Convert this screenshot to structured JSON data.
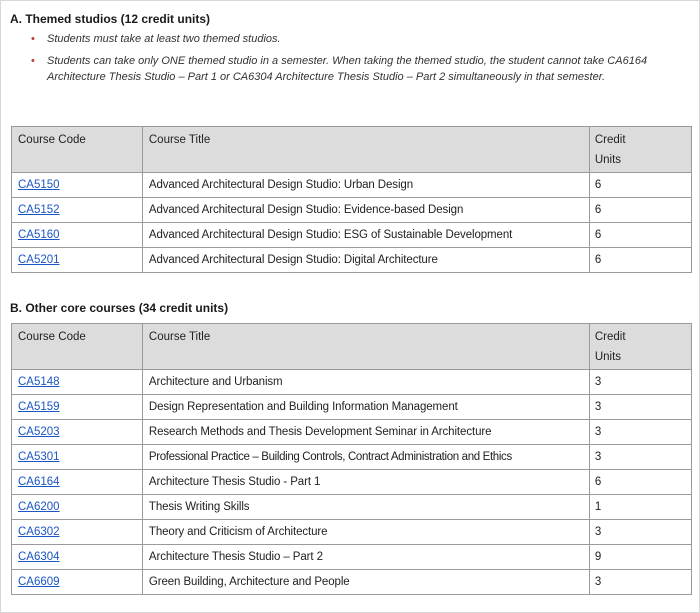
{
  "section_a": {
    "heading": "A. Themed studios (12 credit units)",
    "notes": [
      "Students must take at least two themed studios.",
      "Students can take only ONE themed studio in a semester. When taking the themed studio, the student cannot take CA6164 Architecture Thesis Studio – Part 1 or CA6304 Architecture Thesis Studio – Part 2 simultaneously in that semester."
    ],
    "table": {
      "headers": {
        "code": "Course Code",
        "title": "Course Title",
        "units_line1": "Credit",
        "units_line2": "Units"
      },
      "rows": [
        {
          "code": "CA5150",
          "title": "Advanced Architectural Design Studio: Urban Design",
          "units": "6"
        },
        {
          "code": "CA5152",
          "title": "Advanced Architectural Design Studio: Evidence-based Design",
          "units": "6"
        },
        {
          "code": "CA5160",
          "title": "Advanced Architectural Design Studio: ESG of Sustainable Development",
          "units": "6"
        },
        {
          "code": "CA5201",
          "title": "Advanced Architectural Design Studio: Digital Architecture",
          "units": "6"
        }
      ]
    }
  },
  "section_b": {
    "heading": "B. Other core courses (34 credit units)",
    "table": {
      "headers": {
        "code": "Course Code",
        "title": "Course Title",
        "units_line1": "Credit",
        "units_line2": "Units"
      },
      "rows": [
        {
          "code": "CA5148",
          "title": "Architecture and Urbanism",
          "units": "3"
        },
        {
          "code": "CA5159",
          "title": "Design Representation and Building Information Management",
          "units": "3"
        },
        {
          "code": "CA5203",
          "title": "Research Methods and Thesis Development Seminar in Architecture",
          "units": "3"
        },
        {
          "code": "CA5301",
          "title": "Professional Practice – Building Controls, Contract Administration and Ethics",
          "units": "3"
        },
        {
          "code": "CA6164",
          "title": "Architecture Thesis Studio - Part 1",
          "units": "6"
        },
        {
          "code": "CA6200",
          "title": "Thesis Writing Skills",
          "units": "1"
        },
        {
          "code": "CA6302",
          "title": "Theory and Criticism of Architecture",
          "units": "3"
        },
        {
          "code": "CA6304",
          "title": "Architecture Thesis Studio – Part 2",
          "units": "9"
        },
        {
          "code": "CA6609",
          "title": "Green Building, Architecture and People",
          "units": "3"
        }
      ]
    }
  },
  "colors": {
    "link": "#1a56c4",
    "bullet": "#c0392b",
    "header_bg": "#dcdcdc",
    "border": "#9a9a9a"
  }
}
